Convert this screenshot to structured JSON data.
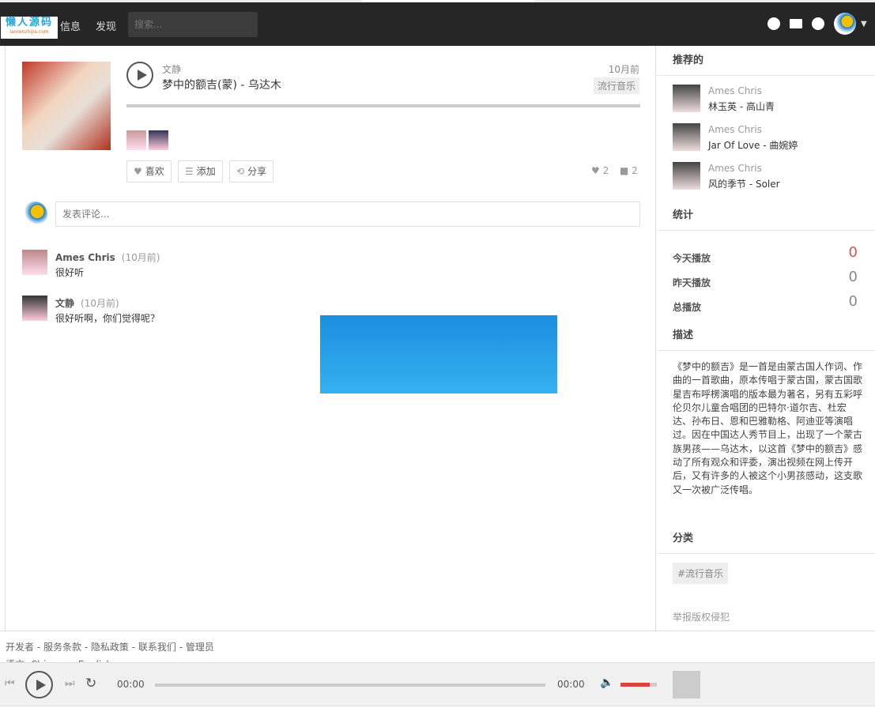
{
  "nav": {
    "logo_text": "懒人源码",
    "logo_sub": "lanrenzhijia.com",
    "links": [
      "信息",
      "发现"
    ],
    "search_placeholder": "搜索..."
  },
  "track": {
    "artist": "文静",
    "title": "梦中的额吉(蒙) - 乌达木",
    "time": "10月前",
    "tag": "流行音乐",
    "progress": 0,
    "actions": {
      "like": "喜欢",
      "add": "添加",
      "share": "分享"
    },
    "like_count": "2",
    "comment_count": "2"
  },
  "comment_placeholder": "发表评论...",
  "comments": [
    {
      "name": "Ames Chris",
      "time": "(10月前)",
      "text": "很好听"
    },
    {
      "name": "文静",
      "time": "(10月前)",
      "text": "很好听啊，你们觉得呢？"
    }
  ],
  "sidebar": {
    "recommended_title": "推荐的",
    "recommended": [
      {
        "user": "Ames Chris",
        "song": "林玉英 - 高山青"
      },
      {
        "user": "Ames Chris",
        "song": "Jar Of Love - 曲婉婷"
      },
      {
        "user": "Ames Chris",
        "song": "风的季节 - Soler"
      }
    ],
    "stats_title": "统计",
    "stats": [
      {
        "label": "今天播放",
        "value": "0"
      },
      {
        "label": "昨天播放",
        "value": "0"
      },
      {
        "label": "总播放",
        "value": "0"
      }
    ],
    "desc_title": "描述",
    "description": "《梦中的额吉》是一首是由蒙古国人作词、作曲的一首歌曲，原本传唱于蒙古国，蒙古国歌星吉布呼楞演唱的版本最为著名，另有五彩呼伦贝尔儿童合唱团的巴特尔·道尔吉、杜宏达、孙布日、恩和巴雅勒格、阿迪亚等演唱过。因在中国达人秀节目上，出现了一个蒙古族男孩——乌达木，以这首《梦中的额吉》感动了所有观众和评委，演出视频在网上传开后，又有许多的人被这个小男孩感动，这支歌又一次被广泛传唱。",
    "category_title": "分类",
    "category_tag": "#流行音乐",
    "report": "举报版权侵犯"
  },
  "footer": {
    "links": "开发者 - 服务条款 - 隐私政策 - 联系我们 - 管理员",
    "language": "语言: Chinese - English"
  },
  "player": {
    "current": "00:00",
    "duration": "00:00",
    "progress": 0,
    "volume": 0.8
  },
  "colors": {
    "nav_bg": "#262626",
    "accent_red": "#e04040",
    "today_count": "#d9534f"
  }
}
